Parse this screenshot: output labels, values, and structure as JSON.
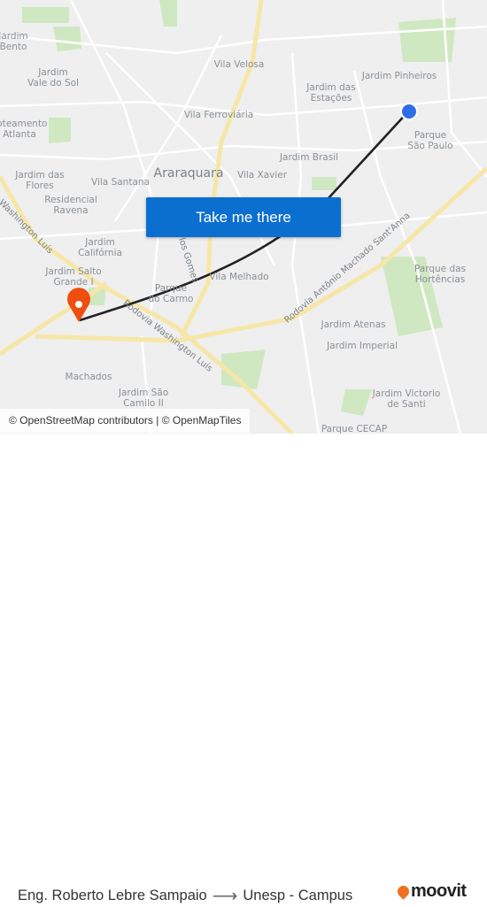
{
  "map": {
    "city_label": "Araraquara",
    "neighborhoods": [
      {
        "name": "Jardim\nBento"
      },
      {
        "name": "Jardim\nVale do Sol"
      },
      {
        "name": "Loteamento\nAtlanta"
      },
      {
        "name": "Jardim das\nFlores"
      },
      {
        "name": "Vila Santana"
      },
      {
        "name": "Residencial\nRavena"
      },
      {
        "name": "Jardim\nCalifórnia"
      },
      {
        "name": "Jardim Salto\nGrande I"
      },
      {
        "name": "Parque\ndo Carmo"
      },
      {
        "name": "Vila Melhado"
      },
      {
        "name": "Machados"
      },
      {
        "name": "Jardim São\nCamilo II"
      },
      {
        "name": "Vila Velosa"
      },
      {
        "name": "Vila Ferroviária"
      },
      {
        "name": "Jardim das\nEstações"
      },
      {
        "name": "Jardim Pinheiros"
      },
      {
        "name": "Parque\nSão Paulo"
      },
      {
        "name": "Jardim Brasil"
      },
      {
        "name": "Vila Xavier"
      },
      {
        "name": "Parque das\nHortências"
      },
      {
        "name": "Jardim Atenas"
      },
      {
        "name": "Jardim Imperial"
      },
      {
        "name": "Jardim Victorio\nde Santi"
      },
      {
        "name": "Parque CECAP"
      }
    ],
    "roads": [
      {
        "name": "Rodovia Washington Luís"
      },
      {
        "name": "Rodovia Antônio Machado Sant'Anna"
      },
      {
        "name": "Washington Luís"
      },
      {
        "name": "R. Carlos Gomes"
      }
    ],
    "origin_marker_color": "#f04e0f",
    "destination_marker_color": "#2f6ee8",
    "route_color": "#222222",
    "attribution": "© OpenStreetMap contributors | © OpenMapTiles"
  },
  "cta": {
    "label": "Take me there",
    "color": "#0b6fd0"
  },
  "footer": {
    "origin": "Eng. Roberto Lebre Sampaio",
    "arrow_icon": "arrow-right-icon",
    "destination": "Unesp - Campus",
    "brand": "moovit",
    "brand_color": "#f26f21"
  }
}
